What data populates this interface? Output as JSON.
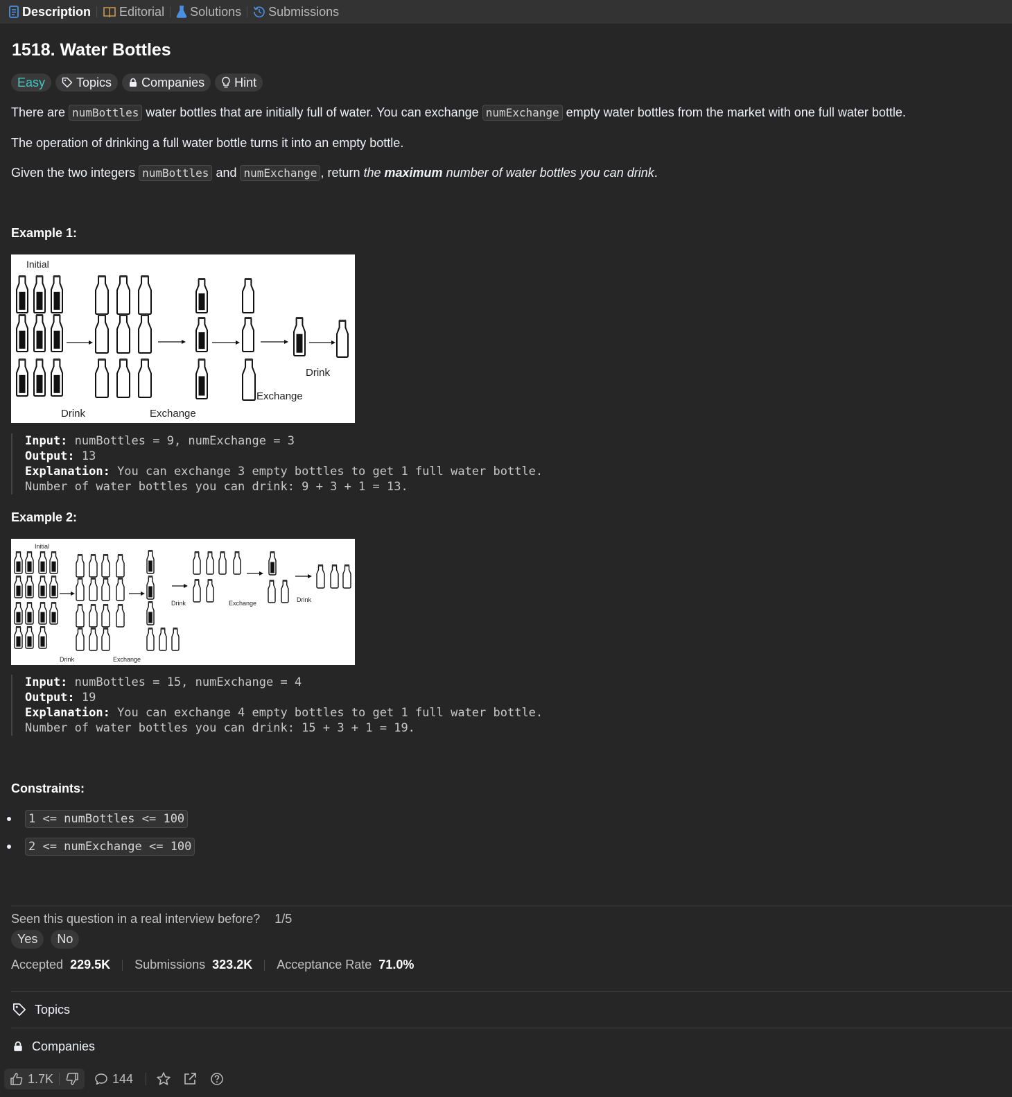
{
  "tabs": [
    {
      "label": "Description",
      "icon": "description-icon",
      "color": "#4a90e2"
    },
    {
      "label": "Editorial",
      "icon": "book-icon",
      "color": "#c99a52"
    },
    {
      "label": "Solutions",
      "icon": "flask-icon",
      "color": "#4a90e2"
    },
    {
      "label": "Submissions",
      "icon": "history-icon",
      "color": "#4a90e2"
    }
  ],
  "problem": {
    "title": "1518. Water Bottles",
    "difficulty": "Easy",
    "difficulty_color": "#46c6c2",
    "tag_topics": "Topics",
    "tag_companies": "Companies",
    "tag_hint": "Hint"
  },
  "description": {
    "p1_a": "There are ",
    "p1_code1": "numBottles",
    "p1_b": " water bottles that are initially full of water. You can exchange ",
    "p1_code2": "numExchange",
    "p1_c": " empty water bottles from the market with one full water bottle.",
    "p2": "The operation of drinking a full water bottle turns it into an empty bottle.",
    "p3_a": "Given the two integers ",
    "p3_code1": "numBottles",
    "p3_b": " and ",
    "p3_code2": "numExchange",
    "p3_c": ", return ",
    "p3_em1": "the ",
    "p3_strong": "maximum",
    "p3_em2": " number of water bottles you can drink",
    "p3_d": "."
  },
  "examples": [
    {
      "heading": "Example 1:",
      "fig_labels": {
        "initial": "Initial",
        "drink1": "Drink",
        "exchange1": "Exchange",
        "exchange2": "Exchange",
        "drink2": "Drink"
      },
      "input_label": "Input:",
      "input": " numBottles = 9, numExchange = 3",
      "output_label": "Output:",
      "output": " 13",
      "explanation_label": "Explanation:",
      "explanation": " You can exchange 3 empty bottles to get 1 full water bottle.",
      "explanation2": "Number of water bottles you can drink: 9 + 3 + 1 = 13."
    },
    {
      "heading": "Example 2:",
      "fig_labels": {
        "initial": "Initial",
        "drink1": "Drink",
        "exchange1": "Exchange",
        "drink2": "Drink",
        "exchange2": "Exchange",
        "drink3": "Drink"
      },
      "input_label": "Input:",
      "input": " numBottles = 15, numExchange = 4",
      "output_label": "Output:",
      "output": " 19",
      "explanation_label": "Explanation:",
      "explanation": " You can exchange 4 empty bottles to get 1 full water bottle.",
      "explanation2": "Number of water bottles you can drink: 15 + 3 + 1 = 19."
    }
  ],
  "constraints": {
    "heading": "Constraints:",
    "items": [
      "1 <= numBottles <= 100",
      "2 <= numExchange <= 100"
    ]
  },
  "interview": {
    "question": "Seen this question in a real interview before?",
    "ratio": "1/5",
    "yes": "Yes",
    "no": "No"
  },
  "stats": {
    "accepted_label": "Accepted",
    "accepted": "229.5K",
    "submissions_label": "Submissions",
    "submissions": "323.2K",
    "rate_label": "Acceptance Rate",
    "rate": "71.0%"
  },
  "sections": {
    "topics": "Topics",
    "companies": "Companies"
  },
  "bottom": {
    "likes": "1.7K",
    "comments": "144"
  }
}
